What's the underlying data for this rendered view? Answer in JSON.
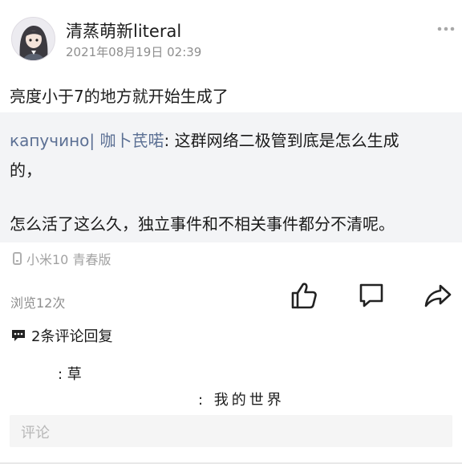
{
  "post": {
    "author": "清蒸萌新literal",
    "timestamp": "2021年08月19日 02:39",
    "text": "亮度小于7的地方就开始生成了"
  },
  "quote": {
    "author": "капучино| 咖卜芪喏",
    "separator": ": ",
    "line1": "这群网络二极管到底是怎么生成",
    "line2": "的，",
    "line3": "怎么活了这么久，独立事件和不相关事件都分不清呢。"
  },
  "device": {
    "label": "小米10 青春版",
    "icon": "phone-icon"
  },
  "stats": {
    "views": "浏览12次"
  },
  "actions": {
    "like_icon": "thumbs-up-icon",
    "comment_icon": "comment-icon",
    "share_icon": "share-icon",
    "more_icon": "more-dots-icon"
  },
  "comments": {
    "title": "2条评论回复",
    "icon": "comment-bubble-icon",
    "replies": [
      {
        "text": ": 草"
      },
      {
        "text": ": 我的世界"
      }
    ],
    "input_placeholder": "评论"
  }
}
